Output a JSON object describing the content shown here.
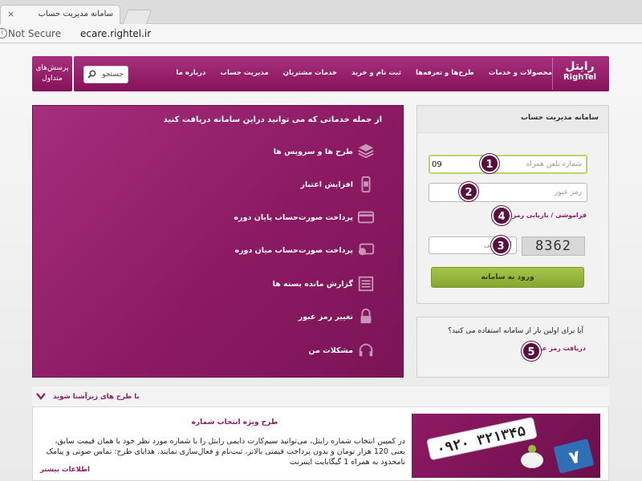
{
  "browser": {
    "tab_title": "سامانه مدیریت حساب",
    "tab_close": "×",
    "security": "Not Secure",
    "url": "ecare.rightel.ir"
  },
  "header": {
    "logo_fa": "رایتل",
    "logo_en": "RighTel",
    "menu": [
      "محصولات و خدمات",
      "طرح‌ها و تعرفه‌ها",
      "ثبت نام و خرید",
      "خدمات مشتریان",
      "مدیریت حساب",
      "درباره ما"
    ],
    "search_placeholder": "جستجو",
    "faq_line1": "پرسش‌های",
    "faq_line2": "متداول"
  },
  "features": {
    "title": "از جمله خدماتی که می توانید دراین سامانه دریافت کنید",
    "items": [
      {
        "label": "طرح ها و سرویس ها",
        "icon": "layers-icon"
      },
      {
        "label": "افزایش اعتبار",
        "icon": "phone-card-icon"
      },
      {
        "label": "پرداخت صورت‌حساب پایان دوره",
        "icon": "credit-card-icon"
      },
      {
        "label": "پرداخت صورت‌حساب میان دوره",
        "icon": "credit-card-coin-icon"
      },
      {
        "label": "گزارش مانده بسته ها",
        "icon": "report-icon"
      },
      {
        "label": "تغییر رمز عبور",
        "icon": "lock-icon"
      },
      {
        "label": "مشکلات من",
        "icon": "headset-icon"
      }
    ]
  },
  "login": {
    "title": "سامانه مدیریت حساب",
    "phone_value": "09",
    "phone_placeholder": "شماره تلفن همراه",
    "password_placeholder": "رمز عبور",
    "forgot_link": "فراموشی / بازیابی رمز عبور",
    "captcha_placeholder": "کد امنیتی",
    "captcha_text": "8362",
    "submit_label": "ورود به سامانه"
  },
  "register": {
    "question": "آیا برای اولین بار از سامانه استفاده می کنید؟",
    "link": "دریافت رمز عبور"
  },
  "badges": [
    "1",
    "2",
    "3",
    "4",
    "5"
  ],
  "promo": {
    "section_title": "با طرح های زیرآشنا شوید",
    "item_title": "طرح ویژه انتخاب شماره",
    "item_body": "در کمپین انتخاب شماره رایتل، می‌توانید سیم‌کارت دایمی رایتل را با شماره مورد نظر خود با همان قیمت سابق، یعنی 120 هزار تومان و بدون پرداخت قیمتی بالاتر، ثبت‌نام و فعال‌سازی نمایند. هدایای طرح: تماس صوتی و پیامک نامحدود به همراه 1 گیگابایت اینترنت",
    "more_link": "اطلاعات بیشتر",
    "image_number": "۰۹۲۰ ۳۲۱۳۴۵",
    "image_digit": "۷"
  },
  "colors": {
    "brand": "#8e1a63",
    "accent_green": "#9bbd3f"
  }
}
